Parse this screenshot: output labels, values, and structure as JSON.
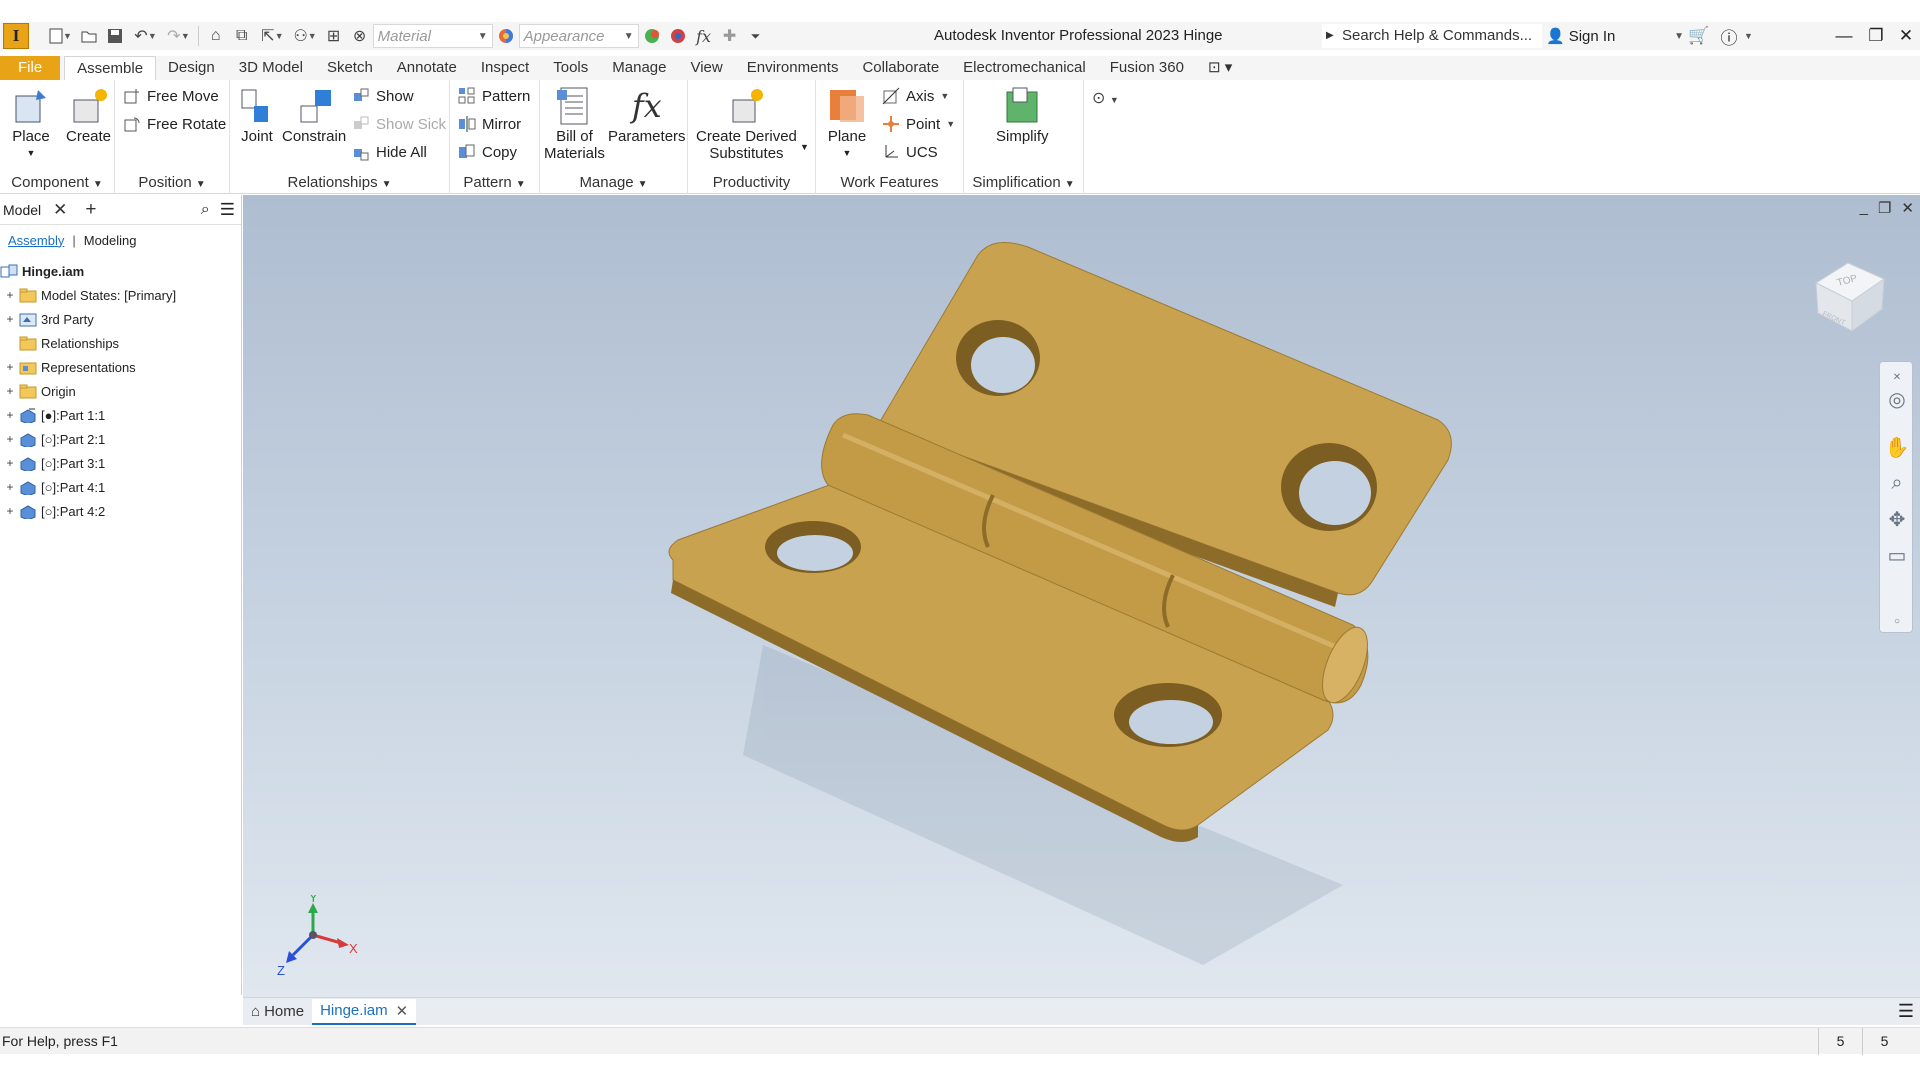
{
  "app": {
    "logo_letter": "I",
    "title": "Autodesk Inventor Professional 2023   Hinge",
    "material_placeholder": "Material",
    "appearance_placeholder": "Appearance",
    "search_placeholder": "Search Help & Commands...",
    "sign_in": "Sign In",
    "accent_color": "#e8a317"
  },
  "menu_tabs": [
    "File",
    "Assemble",
    "Design",
    "3D Model",
    "Sketch",
    "Annotate",
    "Inspect",
    "Tools",
    "Manage",
    "View",
    "Environments",
    "Collaborate",
    "Electromechanical",
    "Fusion 360"
  ],
  "active_tab": "Assemble",
  "ribbon": {
    "component": {
      "label": "Component",
      "place": "Place",
      "create": "Create"
    },
    "position": {
      "label": "Position",
      "free_move": "Free Move",
      "free_rotate": "Free Rotate"
    },
    "relationships": {
      "label": "Relationships",
      "joint": "Joint",
      "constrain": "Constrain",
      "show": "Show",
      "show_sick": "Show Sick",
      "hide_all": "Hide All"
    },
    "pattern": {
      "label": "Pattern",
      "pattern": "Pattern",
      "mirror": "Mirror",
      "copy": "Copy"
    },
    "manage": {
      "label": "Manage",
      "bom_line1": "Bill of",
      "bom_line2": "Materials",
      "parameters": "Parameters"
    },
    "productivity": {
      "label": "Productivity",
      "derived_line1": "Create Derived",
      "derived_line2": "Substitutes"
    },
    "work_features": {
      "label": "Work Features",
      "plane": "Plane",
      "axis": "Axis",
      "point": "Point",
      "ucs": "UCS"
    },
    "simplification": {
      "label": "Simplification",
      "simplify": "Simplify"
    }
  },
  "browser": {
    "title": "Model",
    "subtab_assembly": "Assembly",
    "subtab_modeling": "Modeling",
    "root": "Hinge.iam",
    "items": [
      {
        "label": "Model States: [Primary]",
        "icon": "folder-icon",
        "expandable": true
      },
      {
        "label": "3rd Party",
        "icon": "third-party-icon",
        "expandable": true
      },
      {
        "label": "Relationships",
        "icon": "folder-icon",
        "expandable": false
      },
      {
        "label": "Representations",
        "icon": "representations-icon",
        "expandable": true
      },
      {
        "label": "Origin",
        "icon": "folder-icon",
        "expandable": true
      },
      {
        "label": "[●]:Part 1:1",
        "icon": "grounded-part-icon",
        "expandable": true
      },
      {
        "label": "[○]:Part 2:1",
        "icon": "part-icon",
        "expandable": true
      },
      {
        "label": "[○]:Part 3:1",
        "icon": "part-icon",
        "expandable": true
      },
      {
        "label": "[○]:Part 4:1",
        "icon": "part-icon",
        "expandable": true
      },
      {
        "label": "[○]:Part 4:2",
        "icon": "part-icon",
        "expandable": true
      }
    ]
  },
  "viewport": {
    "viewcube_top": "TOP",
    "viewcube_front": "FRONT",
    "axis_x": "X",
    "axis_y": "Y",
    "axis_z": "Z",
    "model_color": "#c9a24f"
  },
  "doc_tabs": {
    "home": "Home",
    "active": "Hinge.iam"
  },
  "status": {
    "help": "For Help, press F1",
    "count1": "5",
    "count2": "5"
  }
}
